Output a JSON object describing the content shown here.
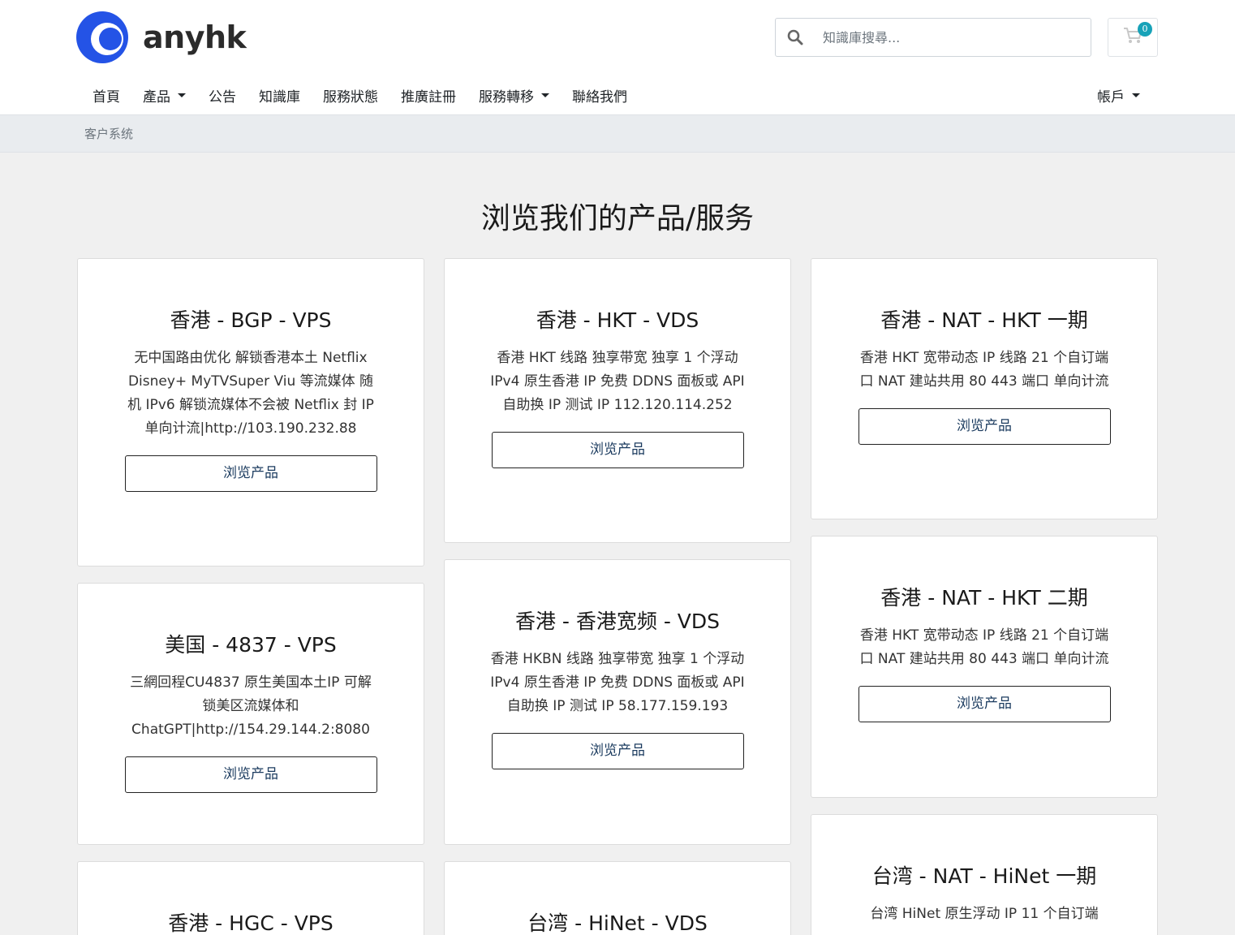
{
  "header": {
    "logo_text": "anyhk",
    "search_placeholder": "知識庫搜尋...",
    "cart_count": "0"
  },
  "nav": {
    "items": [
      {
        "label": "首頁",
        "dropdown": false
      },
      {
        "label": "產品",
        "dropdown": true
      },
      {
        "label": "公告",
        "dropdown": false
      },
      {
        "label": "知識庫",
        "dropdown": false
      },
      {
        "label": "服務狀態",
        "dropdown": false
      },
      {
        "label": "推廣註冊",
        "dropdown": false
      },
      {
        "label": "服務轉移",
        "dropdown": true
      },
      {
        "label": "聯絡我們",
        "dropdown": false
      }
    ],
    "account_label": "帳戶"
  },
  "breadcrumb": "客户系统",
  "page_title": "浏览我们的产品/服务",
  "products": [
    {
      "title": "香港 - BGP - VPS",
      "desc": "无中国路由优化 解锁香港本土 Netflix Disney+ MyTVSuper Viu 等流媒体 随机 IPv6 解锁流媒体不会被 Netflix 封 IP 单向计流|http://103.190.232.88",
      "button": "浏览产品"
    },
    {
      "title": "香港 - HKT - VDS",
      "desc": "香港 HKT 线路 独享带宽 独享 1 个浮动 IPv4 原生香港 IP 免费 DDNS 面板或 API 自助换 IP 测试 IP 112.120.114.252",
      "button": "浏览产品"
    },
    {
      "title": "香港 - NAT - HKT 一期",
      "desc": "香港 HKT 宽带动态 IP 线路 21 个自订端口 NAT 建站共用 80 443 端口 单向计流",
      "button": "浏览产品"
    },
    {
      "title": "美国 - 4837 - VPS",
      "desc": "三網回程CU4837 原生美国本土IP 可解锁美区流媒体和 ChatGPT|http://154.29.144.2:8080",
      "button": "浏览产品"
    },
    {
      "title": "香港 - 香港宽频 - VDS",
      "desc": "香港 HKBN 线路 独享带宽 独享 1 个浮动 IPv4 原生香港 IP 免费 DDNS 面板或 API 自助换 IP 测试 IP 58.177.159.193",
      "button": "浏览产品"
    },
    {
      "title": "香港 - NAT - HKT 二期",
      "desc": "香港 HKT 宽带动态 IP 线路 21 个自订端口 NAT 建站共用 80 443 端口 单向计流",
      "button": "浏览产品"
    },
    {
      "title": "香港 - HGC - VPS",
      "desc": "",
      "button": ""
    },
    {
      "title": "台湾 - HiNet - VDS",
      "desc": "",
      "button": ""
    },
    {
      "title": "台湾 - NAT - HiNet 一期",
      "desc": "台湾 HiNet 原生浮动 IP 11 个自订端",
      "button": ""
    }
  ]
}
